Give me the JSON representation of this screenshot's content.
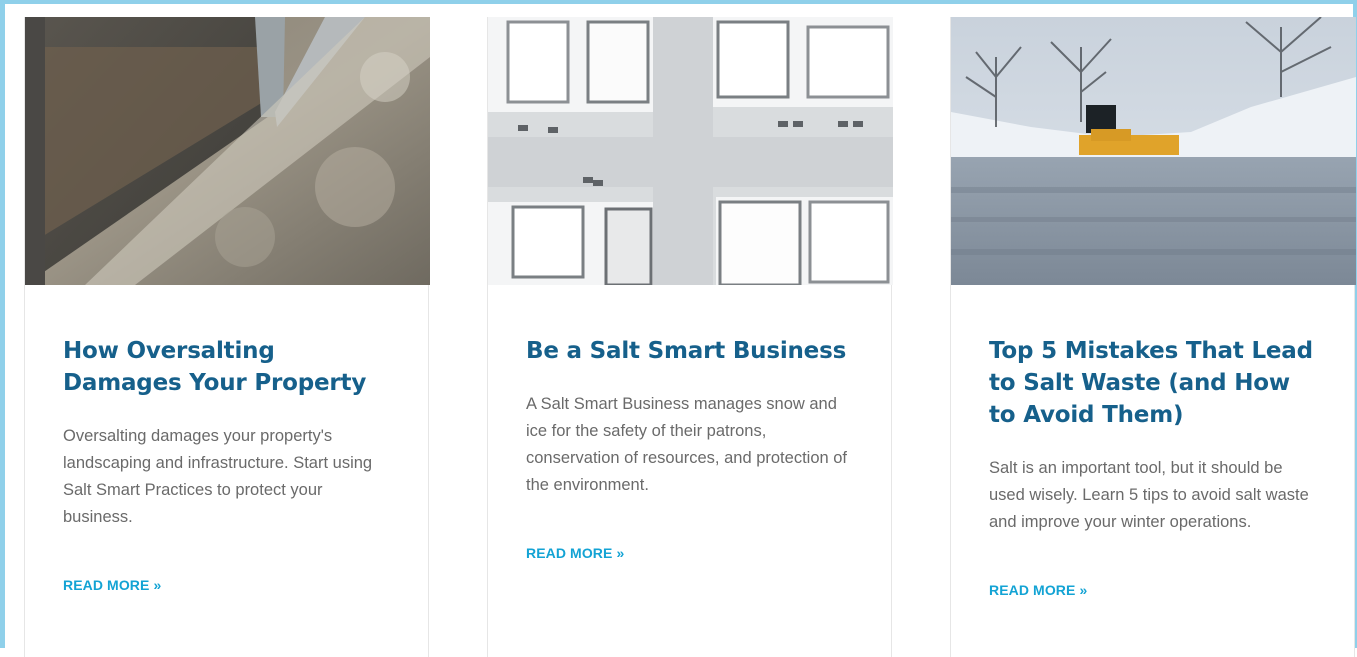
{
  "posts": [
    {
      "image": "oversalted-doorway-photo",
      "title": "How Oversalting Damages Your Property",
      "excerpt": "Oversalting damages your property's landscaping and infrastructure. Start using Salt Smart Practices to protect your business.",
      "read_more": "READ MORE »"
    },
    {
      "image": "aerial-snowy-buildings-photo",
      "title": "Be a Salt Smart Business",
      "excerpt": "A Salt Smart Business manages snow and ice for the safety of their patrons, conservation of resources, and protection of the environment.",
      "read_more": "READ MORE »"
    },
    {
      "image": "snowplow-parking-lot-photo",
      "title": "Top 5 Mistakes That Lead to Salt Waste (and How to Avoid Them)",
      "excerpt": "Salt is an important tool, but it should be used wisely. Learn 5 tips to avoid salt waste and improve your winter operations.",
      "read_more": "READ MORE »"
    }
  ],
  "colors": {
    "title": "#16608b",
    "link": "#13a3d4",
    "text": "#6a6a6a",
    "frame": "#8fd0ea"
  }
}
